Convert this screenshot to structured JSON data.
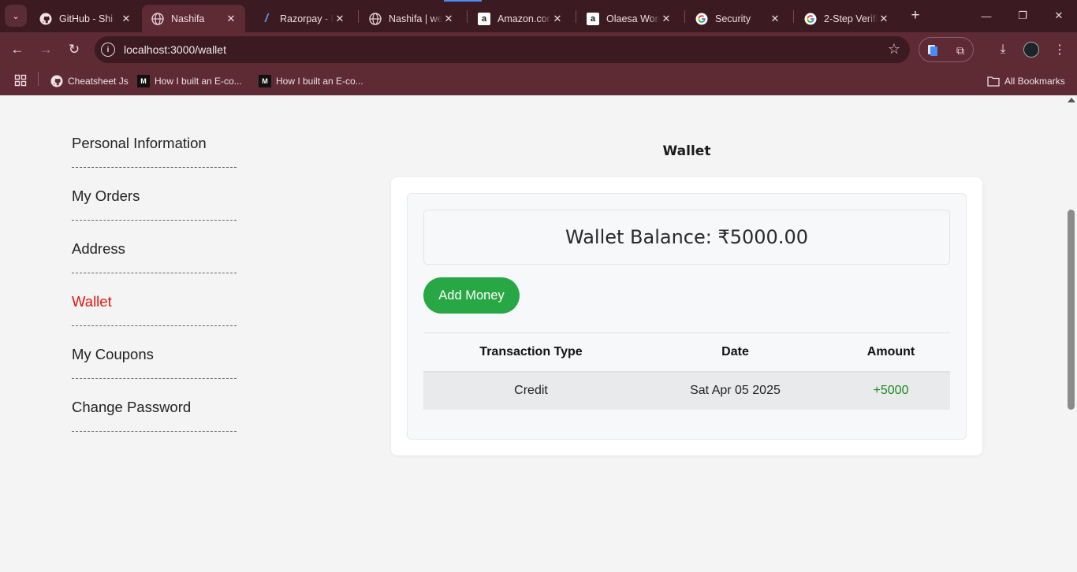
{
  "browser": {
    "tabs": [
      {
        "title": "GitHub - Shi",
        "icon": "github-icon"
      },
      {
        "title": "Nashifa",
        "icon": "globe-icon",
        "active": true
      },
      {
        "title": "Razorpay - B",
        "icon": "razorpay-icon"
      },
      {
        "title": "Nashifa | we",
        "icon": "globe-icon"
      },
      {
        "title": "Amazon.com",
        "icon": "amazon-icon"
      },
      {
        "title": "Olaesa Wom",
        "icon": "amazon-icon"
      },
      {
        "title": "Security",
        "icon": "google-icon"
      },
      {
        "title": "2-Step Verific",
        "icon": "google-icon"
      }
    ],
    "url": "localhost:3000/wallet",
    "bookmarks": [
      {
        "label": "Cheatsheet Js",
        "icon": "github-icon"
      },
      {
        "label": "How I built an E-co...",
        "icon": "medium-icon"
      },
      {
        "label": "How I built an E-co...",
        "icon": "medium-icon"
      }
    ],
    "all_bookmarks_label": "All Bookmarks"
  },
  "sidebar": {
    "items": [
      {
        "label": "Personal Information",
        "active": false
      },
      {
        "label": "My Orders",
        "active": false
      },
      {
        "label": "Address",
        "active": false
      },
      {
        "label": "Wallet",
        "active": true
      },
      {
        "label": "My Coupons",
        "active": false
      },
      {
        "label": "Change Password",
        "active": false
      }
    ],
    "active_color": "#e0140c"
  },
  "wallet": {
    "heading": "Wallet",
    "balance_text": "Wallet Balance: ₹5000.00",
    "add_money_label": "Add Money",
    "add_money_color": "#28a745",
    "table": {
      "headers": [
        "Transaction Type",
        "Date",
        "Amount"
      ],
      "rows": [
        {
          "type": "Credit",
          "date": "Sat Apr 05 2025",
          "amount": "+5000"
        }
      ]
    }
  }
}
